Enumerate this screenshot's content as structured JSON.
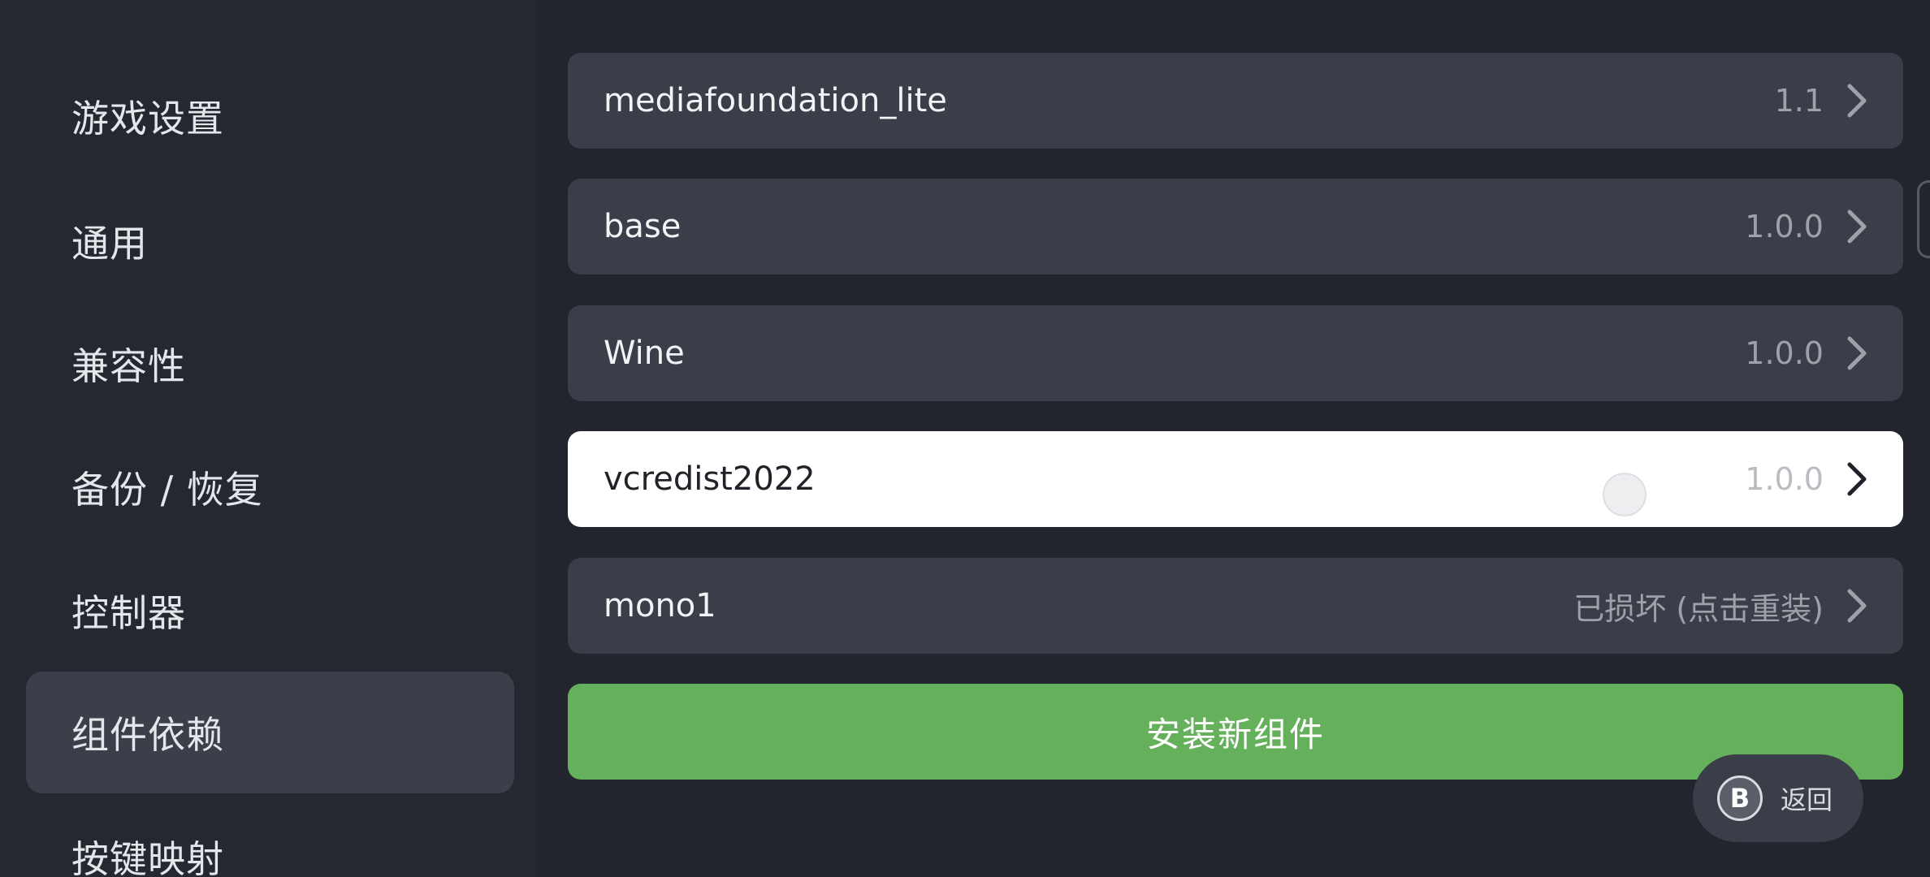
{
  "sidebar": {
    "items": [
      {
        "label": "游戏设置",
        "active": false
      },
      {
        "label": "通用",
        "active": false
      },
      {
        "label": "兼容性",
        "active": false
      },
      {
        "label": "备份 / 恢复",
        "active": false
      },
      {
        "label": "控制器",
        "active": false
      },
      {
        "label": "组件依赖",
        "active": true
      },
      {
        "label": "按键映射",
        "active": false
      }
    ]
  },
  "components": [
    {
      "name": "mediafoundation_lite",
      "version": "1.1"
    },
    {
      "name": "base",
      "version": "1.0.0"
    },
    {
      "name": "Wine",
      "version": "1.0.0"
    },
    {
      "name": "vcredist2022",
      "version": "1.0.0",
      "selected": true
    },
    {
      "name": "mono1",
      "version": "已损坏 (点击重装)"
    }
  ],
  "install_button": {
    "label": "安装新组件"
  },
  "back_hint": {
    "key": "B",
    "label": "返回"
  },
  "colors": {
    "background": "#22252d",
    "row": "#3a3e48",
    "selected_row": "#ffffff",
    "install": "#65b05a"
  }
}
